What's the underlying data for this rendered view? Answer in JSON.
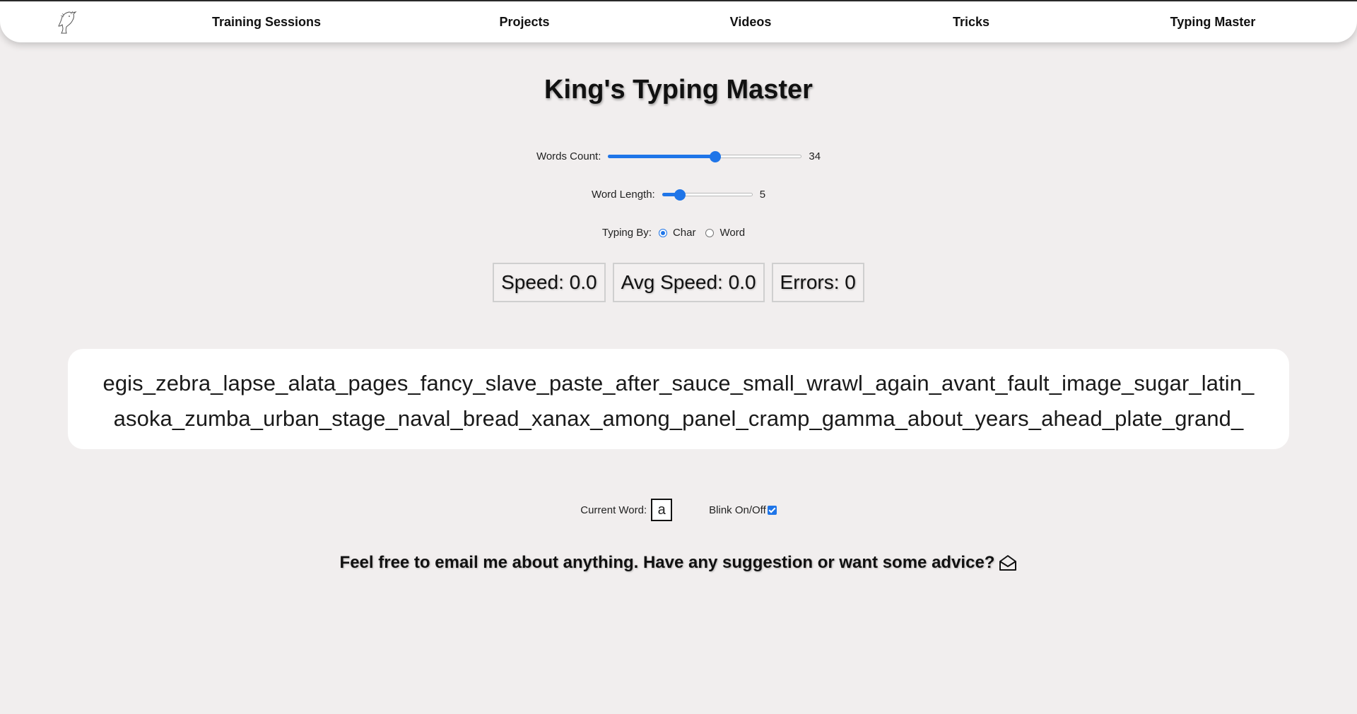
{
  "nav": {
    "logo_icon": "horse-head-logo-icon",
    "items": [
      {
        "label": "Training Sessions"
      },
      {
        "label": "Projects"
      },
      {
        "label": "Videos"
      },
      {
        "label": "Tricks"
      },
      {
        "label": "Typing Master"
      }
    ]
  },
  "title": "King's Typing Master",
  "controls": {
    "words_count": {
      "label": "Words Count:",
      "value": "34",
      "fill_fraction": 0.555
    },
    "word_length": {
      "label": "Word Length:",
      "value": "5",
      "fill_fraction": 0.2
    },
    "typing_by": {
      "label": "Typing By:",
      "options": [
        {
          "label": "Char",
          "selected": true
        },
        {
          "label": "Word",
          "selected": false
        }
      ]
    }
  },
  "stats": {
    "speed": "Speed: 0.0",
    "avg_speed": "Avg Speed: 0.0",
    "errors": "Errors: 0"
  },
  "text_panel": {
    "line1": "egis_zebra_lapse_alata_pages_fancy_slave_paste_after_sauce_small_wrawl_again_avant_fault_image_sugar_latin_",
    "line2": "asoka_zumba_urban_stage_naval_bread_xanax_among_panel_cramp_gamma_about_years_ahead_plate_grand_"
  },
  "current": {
    "label": "Current Word:",
    "value": "a",
    "blink_label": "Blink On/Off",
    "blink_checked": true
  },
  "footer": {
    "message": "Feel free to email me about anything. Have any suggestion or want some advice?",
    "icon": "envelope-open-icon"
  },
  "colors": {
    "accent": "#1f75e8",
    "background": "#f1eeee",
    "panel": "#ffffff"
  }
}
